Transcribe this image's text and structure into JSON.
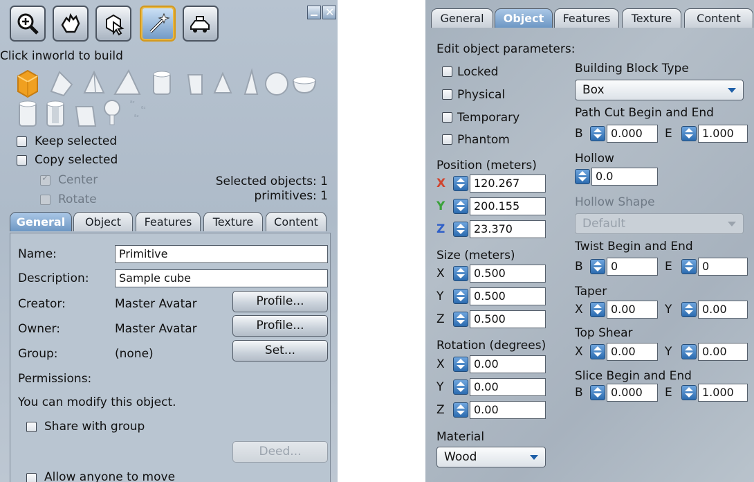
{
  "left": {
    "toolbar": {
      "tools": [
        "zoom-tool-icon",
        "grab-tool-icon",
        "select-tool-icon",
        "create-tool-icon",
        "land-tool-icon"
      ],
      "active": "create-tool-icon"
    },
    "instruction": "Click inworld to build",
    "keep_selected": "Keep selected",
    "copy_selected": "Copy selected",
    "center": "Center",
    "rotate": "Rotate",
    "selected_objects": "Selected objects: 1",
    "primitives": "primitives: 1",
    "tabs": [
      "General",
      "Object",
      "Features",
      "Texture",
      "Content"
    ],
    "general": {
      "name_label": "Name:",
      "name_value": "Primitive",
      "description_label": "Description:",
      "description_value": "Sample cube",
      "creator_label": "Creator:",
      "creator_value": "Master Avatar",
      "owner_label": "Owner:",
      "owner_value": "Master Avatar",
      "group_label": "Group:",
      "group_value": "(none)",
      "profile_button": "Profile...",
      "set_button": "Set...",
      "permissions_label": "Permissions:",
      "modify_text": "You can modify this object.",
      "share_with_group": "Share with group",
      "deed_button": "Deed...",
      "allow_anyone_to_move": "Allow anyone to move"
    }
  },
  "right": {
    "tabs": [
      "General",
      "Object",
      "Features",
      "Texture",
      "Content"
    ],
    "edit_params": "Edit object parameters:",
    "checkboxes": [
      "Locked",
      "Physical",
      "Temporary",
      "Phantom"
    ],
    "position_label": "Position (meters)",
    "position": {
      "x": "120.267",
      "y": "200.155",
      "z": "23.370"
    },
    "size_label": "Size (meters)",
    "size": {
      "x": "0.500",
      "y": "0.500",
      "z": "0.500"
    },
    "rotation_label": "Rotation (degrees)",
    "rotation": {
      "x": "0.00",
      "y": "0.00",
      "z": "0.00"
    },
    "material_label": "Material",
    "material_value": "Wood",
    "block_type_label": "Building Block Type",
    "block_type_value": "Box",
    "path_cut_label": "Path Cut Begin and End",
    "path_cut": {
      "b": "0.000",
      "e": "1.000"
    },
    "hollow_label": "Hollow",
    "hollow_value": "0.0",
    "hollow_shape_label": "Hollow Shape",
    "hollow_shape_value": "Default",
    "twist_label": "Twist Begin and End",
    "twist": {
      "b": "0",
      "e": "0"
    },
    "taper_label": "Taper",
    "taper": {
      "x": "0.00",
      "y": "0.00"
    },
    "top_shear_label": "Top Shear",
    "top_shear": {
      "x": "0.00",
      "y": "0.00"
    },
    "slice_label": "Slice Begin and End",
    "slice": {
      "b": "0.000",
      "e": "1.000"
    },
    "letters": {
      "x": "X",
      "y": "Y",
      "z": "Z",
      "b": "B",
      "e": "E"
    }
  },
  "colors": {
    "x_axis": "#d0452f",
    "y_axis": "#3aa23a",
    "z_axis": "#2f5fc8",
    "active_tab": "#6d97c4"
  }
}
